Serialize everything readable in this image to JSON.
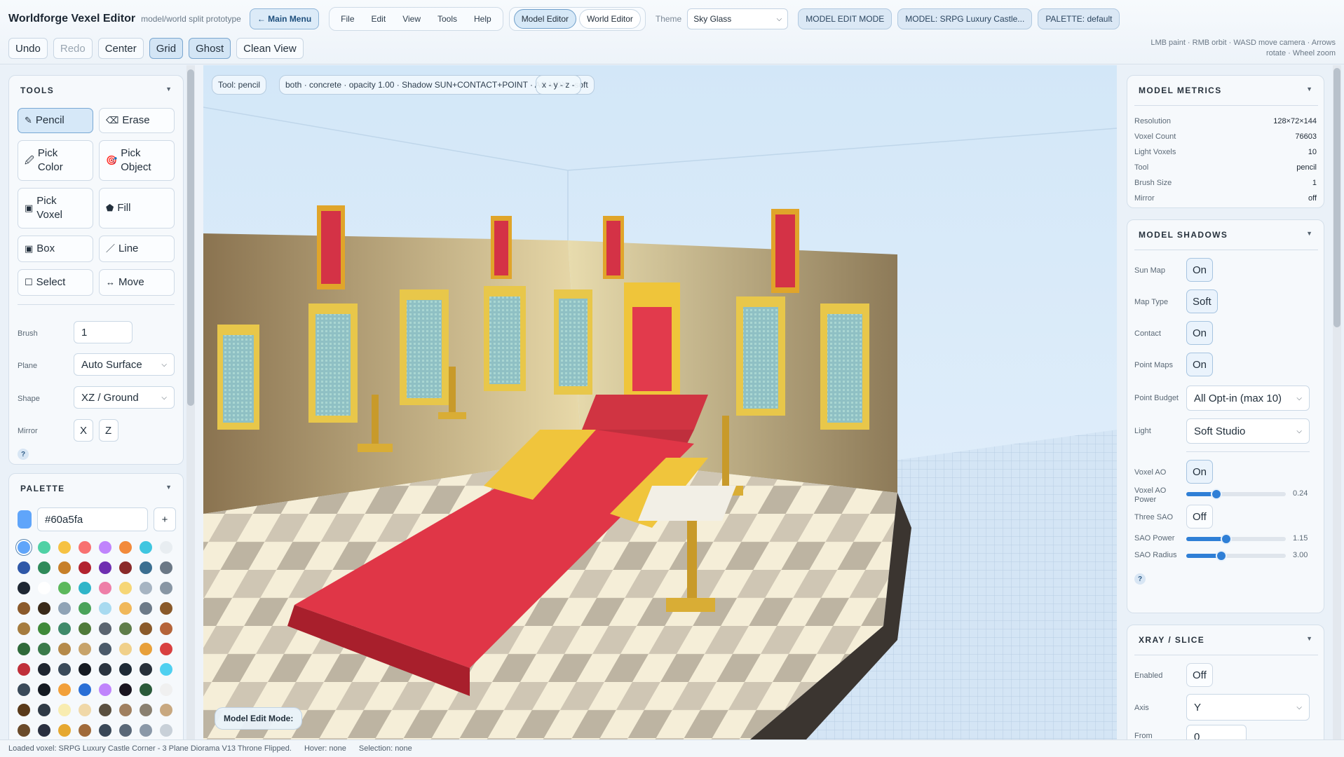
{
  "app": {
    "title": "Worldforge Vexel Editor",
    "subtitle": "model/world split prototype",
    "main_menu": "← Main Menu"
  },
  "menu": [
    "File",
    "Edit",
    "View",
    "Tools",
    "Help"
  ],
  "editor_tabs": [
    {
      "label": "Model Editor",
      "active": true
    },
    {
      "label": "World Editor",
      "active": false
    }
  ],
  "theme": {
    "label": "Theme",
    "value": "Sky Glass"
  },
  "badges": {
    "mode": "MODEL EDIT MODE",
    "model": "MODEL: SRPG Luxury Castle...",
    "palette": "PALETTE: default"
  },
  "toolbar": [
    {
      "label": "Undo",
      "state": "normal"
    },
    {
      "label": "Redo",
      "state": "disabled"
    },
    {
      "label": "Center",
      "state": "normal"
    },
    {
      "label": "Grid",
      "state": "active"
    },
    {
      "label": "Ghost",
      "state": "active"
    },
    {
      "label": "Clean View",
      "state": "normal"
    }
  ],
  "controls_hint": {
    "line1": "LMB paint · RMB orbit · WASD move camera · Arrows",
    "line2": "rotate · Wheel zoom"
  },
  "tools_panel": {
    "title": "TOOLS",
    "tools": [
      {
        "icon": "✎",
        "icon_name": "pencil-icon",
        "label": "Pencil",
        "active": true
      },
      {
        "icon": "⌫",
        "icon_name": "eraser-icon",
        "label": "Erase",
        "active": false
      },
      {
        "icon": "🖉",
        "icon_name": "eyedropper-icon",
        "label": "Pick Color",
        "active": false
      },
      {
        "icon": "🎯",
        "icon_name": "target-icon",
        "label": "Pick Object",
        "active": false
      },
      {
        "icon": "▣",
        "icon_name": "voxel-icon",
        "label": "Pick Voxel",
        "active": false
      },
      {
        "icon": "⬟",
        "icon_name": "fill-icon",
        "label": "Fill",
        "active": false
      },
      {
        "icon": "▣",
        "icon_name": "box-icon",
        "label": "Box",
        "active": false
      },
      {
        "icon": "／",
        "icon_name": "line-icon",
        "label": "Line",
        "active": false
      },
      {
        "icon": "☐",
        "icon_name": "select-icon",
        "label": "Select",
        "active": false
      },
      {
        "icon": "↔",
        "icon_name": "move-icon",
        "label": "Move",
        "active": false
      }
    ],
    "brush": {
      "label": "Brush",
      "value": "1"
    },
    "plane": {
      "label": "Plane",
      "value": "Auto Surface"
    },
    "shape": {
      "label": "Shape",
      "value": "XZ / Ground"
    },
    "mirror": {
      "label": "Mirror",
      "x": "X",
      "z": "Z"
    },
    "help": "?"
  },
  "palette_panel": {
    "title": "PALETTE",
    "current_color": "#60a5fa",
    "add_label": "+",
    "swatches": [
      "#60a5fa",
      "#4fd1a5",
      "#f6c244",
      "#f87171",
      "#c084fc",
      "#f28a3b",
      "#3fc6e0",
      "#e8edf1",
      "#2f58a8",
      "#2f8a5a",
      "#c7802a",
      "#b2232f",
      "#6f2fb1",
      "#8a2a2a",
      "#3b6f91",
      "#6b7886",
      "#1f2733",
      "#ffffff",
      "#5cb85c",
      "#2fb5c9",
      "#ee7fa8",
      "#f6d676",
      "#a6b4c2",
      "#8896a4",
      "#8b5a2b",
      "#3a2a1a",
      "#8fa3b6",
      "#4aa35a",
      "#a8daf0",
      "#f0b85a",
      "#6c7a88",
      "#8a5a2a",
      "#a67c3f",
      "#3f8a3a",
      "#3f8a6a",
      "#4f7a3a",
      "#5a6470",
      "#5f7d4a",
      "#8a5a2a",
      "#b5643a",
      "#2f6a3a",
      "#3a7a4a",
      "#b58a4a",
      "#c7a36a",
      "#4a5a6a",
      "#f0d08a",
      "#e8a03a",
      "#d94040",
      "#c0303a",
      "#1e2530",
      "#3a4a5a",
      "#151a22",
      "#2a3440",
      "#1e2a36",
      "#27303a",
      "#4fd0f0",
      "#3a4a5a",
      "#141a22",
      "#f2a03a",
      "#2a6fd6",
      "#c084fc",
      "#1a1520",
      "#2a5a3a",
      "#f0f0f0",
      "#5a3a1a",
      "#2f3a46",
      "#f8ecb0",
      "#f0d8a8",
      "#5a5040",
      "#a08060",
      "#8a8070",
      "#c8a880",
      "#6a4a2a",
      "#2a3040",
      "#e6a830",
      "#a06a3a",
      "#3a4858",
      "#5a6878",
      "#8a98a8",
      "#c8d0d8"
    ]
  },
  "viewport": {
    "chips": [
      "Tool: pencil",
      "both · concrete · opacity 1.00 · Shadow SUN+CONTACT+POINT · AO VOX · soft",
      "x - y - z -"
    ],
    "mode_label": "Model Edit Mode:"
  },
  "metrics_panel": {
    "title": "MODEL METRICS",
    "rows": [
      {
        "label": "Resolution",
        "value": "128×72×144"
      },
      {
        "label": "Voxel Count",
        "value": "76603"
      },
      {
        "label": "Light Voxels",
        "value": "10"
      },
      {
        "label": "Tool",
        "value": "pencil"
      },
      {
        "label": "Brush Size",
        "value": "1"
      },
      {
        "label": "Mirror",
        "value": "off"
      }
    ]
  },
  "shadows_panel": {
    "title": "MODEL SHADOWS",
    "sun_map": {
      "label": "Sun Map",
      "value": "On"
    },
    "map_type": {
      "label": "Map Type",
      "value": "Soft"
    },
    "contact": {
      "label": "Contact",
      "value": "On"
    },
    "point_maps": {
      "label": "Point Maps",
      "value": "On"
    },
    "point_budget": {
      "label": "Point Budget",
      "value": "All Opt-in (max 10)"
    },
    "light": {
      "label": "Light",
      "value": "Soft Studio"
    },
    "voxel_ao": {
      "label": "Voxel AO",
      "value": "On"
    },
    "voxel_ao_power": {
      "label_1": "Voxel AO",
      "label_2": "Power",
      "value": "0.24",
      "fraction": 0.3
    },
    "three_sao": {
      "label": "Three SAO",
      "value": "Off"
    },
    "sao_power": {
      "label": "SAO Power",
      "value": "1.15",
      "fraction": 0.4
    },
    "sao_radius": {
      "label": "SAO Radius",
      "value": "3.00",
      "fraction": 0.35
    },
    "help": "?"
  },
  "xray_panel": {
    "title": "XRAY / SLICE",
    "enabled": {
      "label": "Enabled",
      "value": "Off"
    },
    "axis": {
      "label": "Axis",
      "value": "Y"
    },
    "from": {
      "label": "From",
      "value": "0"
    }
  },
  "status": {
    "loaded": "Loaded voxel: SRPG Luxury Castle Corner - 3 Plane Diorama V13 Throne Flipped.",
    "hover": "Hover: none",
    "selection": "Selection: none"
  }
}
